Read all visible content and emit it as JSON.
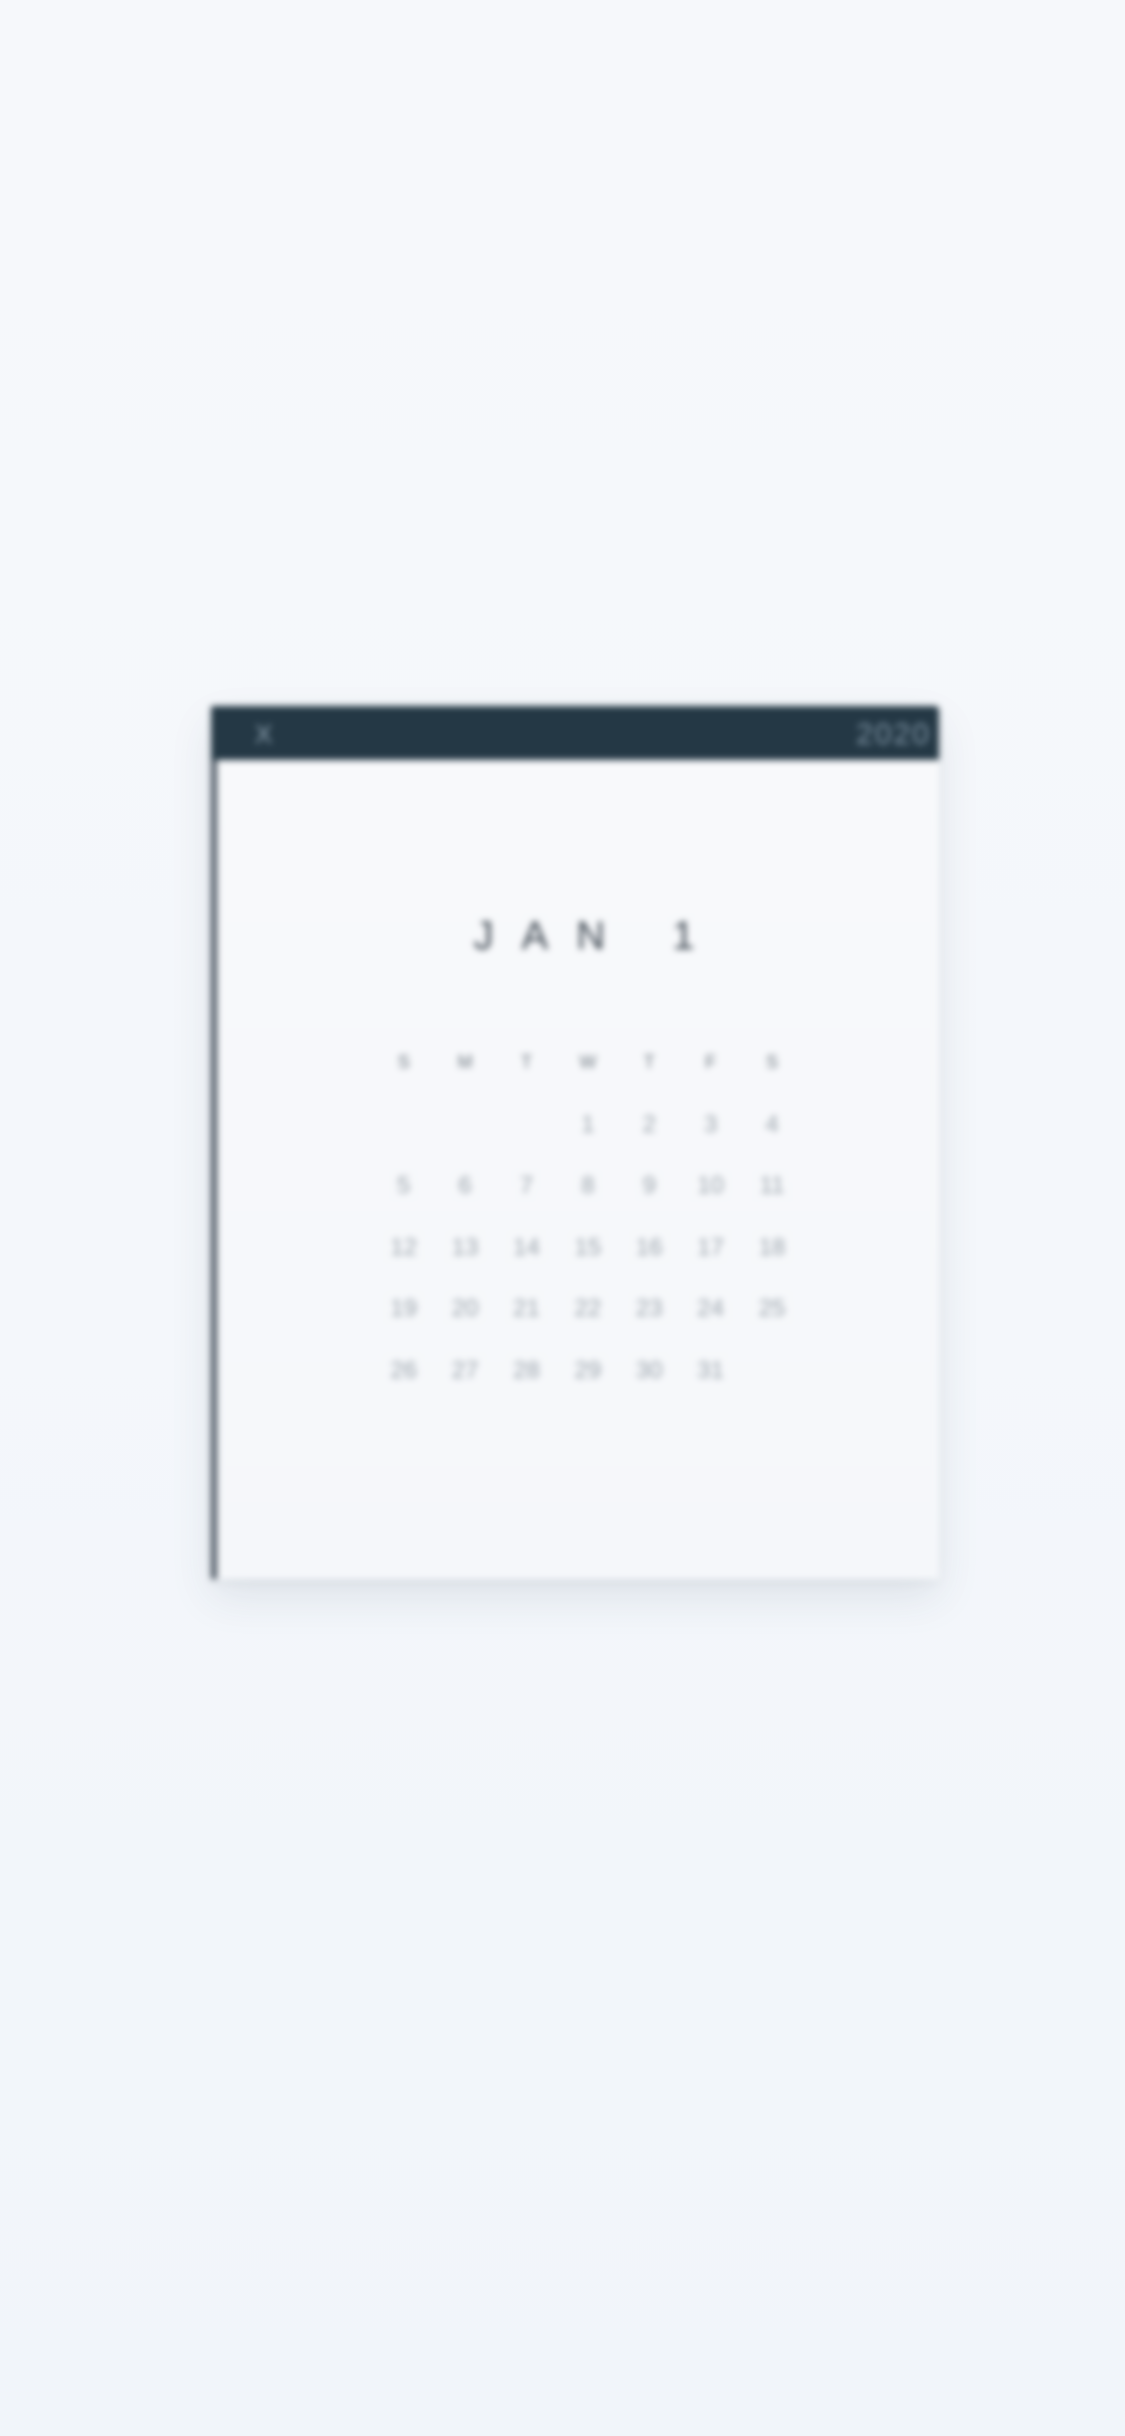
{
  "calendar": {
    "header_left": "X",
    "header_right": "2020",
    "month_title": "JAN  1",
    "weekdays": [
      "S",
      "M",
      "T",
      "W",
      "T",
      "F",
      "S"
    ],
    "days": [
      "",
      "",
      "",
      "1",
      "2",
      "3",
      "4",
      "5",
      "6",
      "7",
      "8",
      "9",
      "10",
      "11",
      "12",
      "13",
      "14",
      "15",
      "16",
      "17",
      "18",
      "19",
      "20",
      "21",
      "22",
      "23",
      "24",
      "25",
      "26",
      "27",
      "28",
      "29",
      "30",
      "31",
      ""
    ]
  },
  "colors": {
    "header_bar": "#243845",
    "background": "#f4f7fb",
    "paper": "#f7f8fa",
    "text": "#3c4650"
  }
}
